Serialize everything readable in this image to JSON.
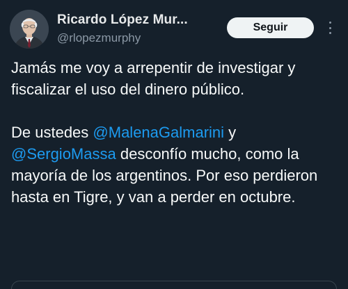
{
  "author": {
    "display_name": "Ricardo López Mur...",
    "handle": "@rlopezmurphy"
  },
  "actions": {
    "follow_label": "Seguir",
    "more_icon": "more-icon"
  },
  "tweet": {
    "paragraph1": "Jamás me voy a arrepentir de investigar y fiscalizar el uso del dinero público.",
    "p2_prefix": "De ustedes ",
    "mention1": "@MalenaGalmarini",
    "p2_mid": " y ",
    "mention2": "@SergioMassa",
    "p2_suffix": " desconfío mucho, como la mayoría de los argentinos. Por eso perdieron hasta en Tigre, y van a perder en octubre."
  },
  "colors": {
    "background": "#15202b",
    "text": "#f7f9f9",
    "secondary_text": "#8b98a5",
    "mention": "#1d9bf0",
    "button_bg": "#eff3f4"
  }
}
